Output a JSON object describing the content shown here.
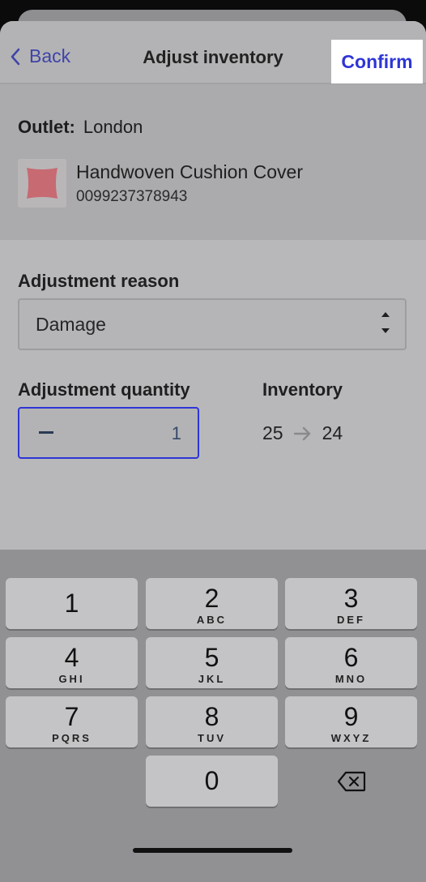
{
  "header": {
    "back_label": "Back",
    "title": "Adjust inventory",
    "confirm_label": "Confirm"
  },
  "outlet": {
    "label": "Outlet:",
    "value": "London"
  },
  "product": {
    "name": "Handwoven Cushion Cover",
    "sku": "0099237378943"
  },
  "adjustment": {
    "reason_label": "Adjustment reason",
    "reason_value": "Damage",
    "quantity_label": "Adjustment quantity",
    "quantity_value": "1",
    "inventory_label": "Inventory",
    "inventory_from": "25",
    "inventory_to": "24"
  },
  "keypad": {
    "keys": [
      {
        "num": "1",
        "letters": ""
      },
      {
        "num": "2",
        "letters": "ABC"
      },
      {
        "num": "3",
        "letters": "DEF"
      },
      {
        "num": "4",
        "letters": "GHI"
      },
      {
        "num": "5",
        "letters": "JKL"
      },
      {
        "num": "6",
        "letters": "MNO"
      },
      {
        "num": "7",
        "letters": "PQRS"
      },
      {
        "num": "8",
        "letters": "TUV"
      },
      {
        "num": "9",
        "letters": "WXYZ"
      },
      {
        "num": "0",
        "letters": ""
      }
    ]
  },
  "colors": {
    "accent": "#2e35d6",
    "back_link": "#3f44a8"
  }
}
